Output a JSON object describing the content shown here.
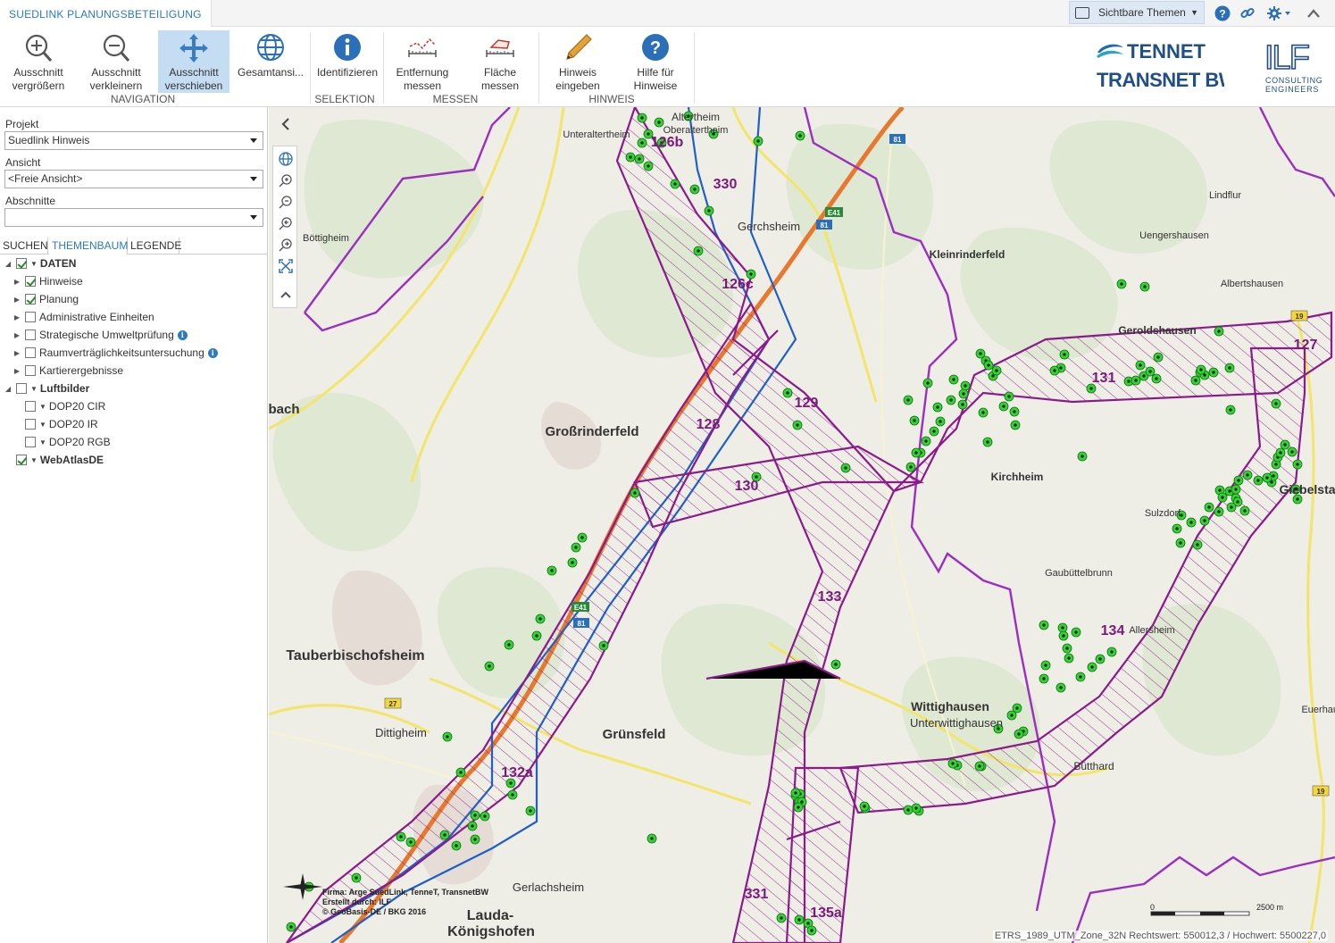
{
  "app": {
    "title": "SUEDLINK PLANUNGSBETEILIGUNG",
    "themes_button": "Sichtbare Themen"
  },
  "toolbar": {
    "tools": {
      "zoom_in": [
        "Ausschnitt",
        "vergrößern"
      ],
      "zoom_out": [
        "Ausschnitt",
        "verkleinern"
      ],
      "pan": [
        "Ausschnitt",
        "verschieben"
      ],
      "full_extent": [
        "Gesamtansi...",
        ""
      ],
      "identify": [
        "Identifizieren",
        ""
      ],
      "measure_distance": [
        "Entfernung",
        "messen"
      ],
      "measure_area": [
        "Fläche",
        "messen"
      ],
      "add_note": [
        "Hinweis",
        "eingeben"
      ],
      "help": [
        "Hilfe für",
        "Hinweise"
      ]
    },
    "groups": {
      "navigation": "NAVIGATION",
      "selection": "SELEKTION",
      "measure": "MESSEN",
      "note": "HINWEIS"
    }
  },
  "logos": {
    "tennet_top": "TENNET",
    "tennet_bottom": "TRANSNET BW",
    "ilf_mark": "ILF",
    "ilf_line1": "CONSULTING",
    "ilf_line2": "ENGINEERS"
  },
  "sidebar": {
    "project_label": "Projekt",
    "project_value": "Suedlink Hinweis",
    "view_label": "Ansicht",
    "view_value": "<Freie Ansicht>",
    "sections_label": "Abschnitte",
    "sections_value": "",
    "tabs": [
      "SUCHEN",
      "THEMENBAUM",
      "LEGENDE"
    ],
    "tree": [
      {
        "label": "DATEN",
        "checked": true,
        "bold": true
      },
      {
        "label": "Hinweise",
        "checked": true
      },
      {
        "label": "Planung",
        "checked": true
      },
      {
        "label": "Administrative Einheiten",
        "checked": false
      },
      {
        "label": "Strategische Umweltprüfung",
        "checked": false,
        "info": true
      },
      {
        "label": "Raumverträglichkeitsuntersuchung",
        "checked": false,
        "info": true
      },
      {
        "label": "Kartierergebnisse",
        "checked": false
      },
      {
        "label": "Luftbilder",
        "checked": false,
        "bold": true
      },
      {
        "label": "DOP20 CIR",
        "checked": false
      },
      {
        "label": "DOP20 IR",
        "checked": false
      },
      {
        "label": "DOP20 RGB",
        "checked": false
      },
      {
        "label": "WebAtlasDE",
        "checked": true,
        "bold": true
      }
    ]
  },
  "map": {
    "places": {
      "tauberbischofsheim": "Tauberbischofsheim",
      "grossrinderfeld": "Großrinderfeld",
      "gruensfeld": "Grünsfeld",
      "wittighausen": "Wittighausen",
      "unterwittighausen": "Unterwittighausen",
      "kirchheim": "Kirchheim",
      "kleinrinderfeld": "Kleinrinderfeld",
      "geroldshausen": "Geroldshausen",
      "giebelstadt": "Giebelsta",
      "dittigheim": "Dittigheim",
      "gerlachsheim": "Gerlachsheim",
      "lauda": "Lauda-",
      "koenigshofen": "Königshofen",
      "boettigheim": "Böttigheim",
      "gerchsheim": "Gerchsheim",
      "unteraltertheim": "Unteraltertheim",
      "sulzdorf": "Sulzdorf",
      "gaubuettelbrunn": "Gaubüttelbrunn",
      "buetthard": "Bütthard",
      "allersheim": "Allersheim",
      "lindflur": "Lindflur",
      "uengershausen": "Uengershausen",
      "albertshausen": "Albertshausen",
      "euerhausen": "Euerhaus",
      "bach": "bach",
      "altertheim": "Altertheim",
      "oberaltertheim": "Oberaltertheim"
    },
    "segments": {
      "s126b": "126b",
      "s330": "330",
      "s126c": "126c",
      "s129": "129",
      "s128": "128",
      "s130": "130",
      "s131": "131",
      "s127": "127",
      "s133": "133",
      "s134": "134",
      "s132a": "132a",
      "s331": "331",
      "s135a": "135a"
    },
    "roads": {
      "e41a": "E41",
      "r81a": "81",
      "r81b": "81",
      "e41b": "E41",
      "r81c": "81",
      "r19a": "19",
      "r19b": "19",
      "r27": "27"
    },
    "credits": [
      "Firma: Arge SuedLink, TenneT, TransnetBW",
      "Erstellt durch: ILF",
      "© GeoBasis-DE / BKG 2016"
    ],
    "scale": {
      "zero": "0",
      "distance": "2500 m"
    },
    "coords": "ETRS_1989_UTM_Zone_32N Rechtswert: 550012,3 / Hochwert: 5500227,0"
  },
  "colors": {
    "accent": "#2a7bc0",
    "corridor": "#8b1a8b",
    "boundary": "#9b2fc0",
    "blue_corridor": "#1f5fc6",
    "motorway": "#e8782e",
    "road": "#e8d84a",
    "note_point": "#2fd62f"
  },
  "icons": {
    "zoom_in": "zoom-in-icon",
    "zoom_out": "zoom-out-icon",
    "pan": "pan-icon",
    "full_extent": "globe-icon",
    "identify": "info-icon",
    "distance": "ruler-icon",
    "area": "area-icon",
    "note": "pencil-icon",
    "help": "help-icon"
  }
}
